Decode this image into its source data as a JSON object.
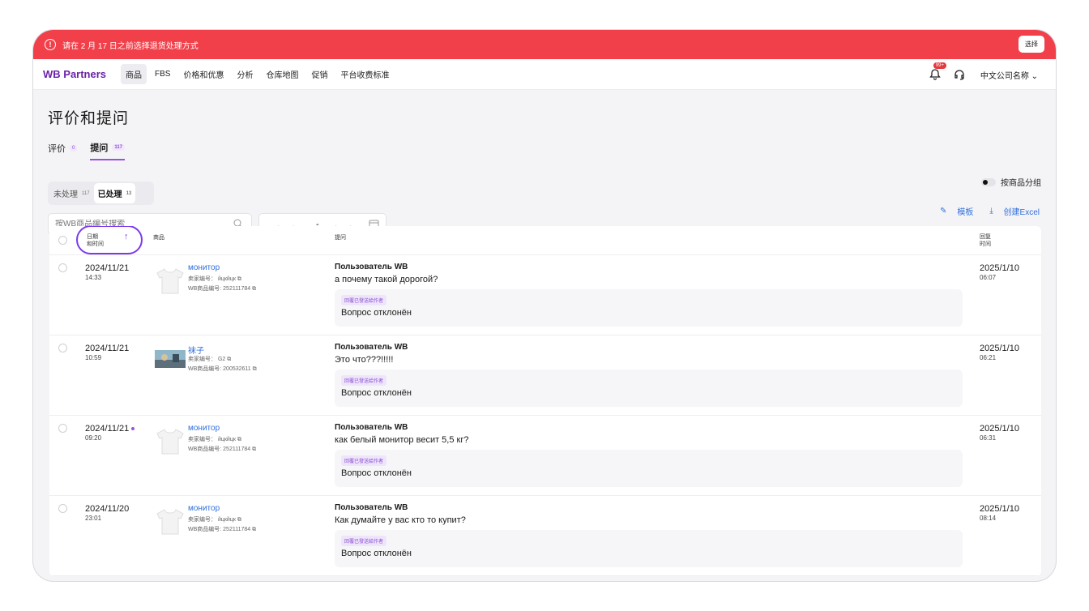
{
  "alert": {
    "text": "请在 2 月 17 日之前选择退货处理方式",
    "button": "选择"
  },
  "nav": {
    "logo": "WB Partners",
    "items": [
      "商品",
      "FBS",
      "价格和优惠",
      "分析",
      "仓库地图",
      "促销",
      "平台收费标准"
    ],
    "badge": "99+",
    "company": "中文公司名称"
  },
  "page": {
    "title": "评价和提问"
  },
  "tabs": [
    {
      "label": "评价",
      "count": "0"
    },
    {
      "label": "提问",
      "count": "117"
    }
  ],
  "segments": [
    {
      "label": "未处理",
      "count": "117"
    },
    {
      "label": "已处理",
      "count": "13"
    }
  ],
  "toggle": {
    "label": "按商品分组"
  },
  "search": {
    "placeholder": "按WB商品编号搜索"
  },
  "date_range": {
    "value": "__.__.___ - __.__.___"
  },
  "actions": {
    "template": "模板",
    "excel": "创建Excel"
  },
  "table": {
    "headers": {
      "datetime_line1": "日期",
      "datetime_line2": "和时间",
      "product": "商品",
      "question": "提问",
      "reply_line1": "回复",
      "reply_line2": "时间"
    },
    "rows": [
      {
        "date": "2024/11/21",
        "time": "14:33",
        "product": "монитор",
        "seller": "卖家编号： йцкйцк",
        "wb": "WB商品编号: 252111784",
        "user": "Пользователь WB",
        "question": "а почему такой дорогой?",
        "tag": "回覆已發送給作者",
        "answer": "Вопрос отклонён",
        "rdate": "2025/1/10",
        "rtime": "06:07"
      },
      {
        "date": "2024/11/21",
        "time": "10:59",
        "product": "袜子",
        "seller": "卖家编号： G2",
        "wb": "WB商品编号: 200532611",
        "user": "Пользователь WB",
        "question": "Это что???!!!!!",
        "tag": "回覆已發送給作者",
        "answer": "Вопрос отклонён",
        "rdate": "2025/1/10",
        "rtime": "06:21"
      },
      {
        "date": "2024/11/21",
        "time": "09:20",
        "product": "монитор",
        "seller": "卖家编号： йцкйцк",
        "wb": "WB商品编号: 252111784",
        "user": "Пользователь WB",
        "question": "как белый монитор весит 5,5 кг?",
        "tag": "回覆已發送給作者",
        "answer": "Вопрос отклонён",
        "rdate": "2025/1/10",
        "rtime": "06:31"
      },
      {
        "date": "2024/11/20",
        "time": "23:01",
        "product": "монитор",
        "seller": "卖家编号： йцкйцк",
        "wb": "WB商品编号: 252111784",
        "user": "Пользователь WB",
        "question": "Как думайте у вас кто то купит?",
        "tag": "回覆已發送給作者",
        "answer": "Вопрос отклонён",
        "rdate": "2025/1/10",
        "rtime": "08:14"
      }
    ]
  }
}
